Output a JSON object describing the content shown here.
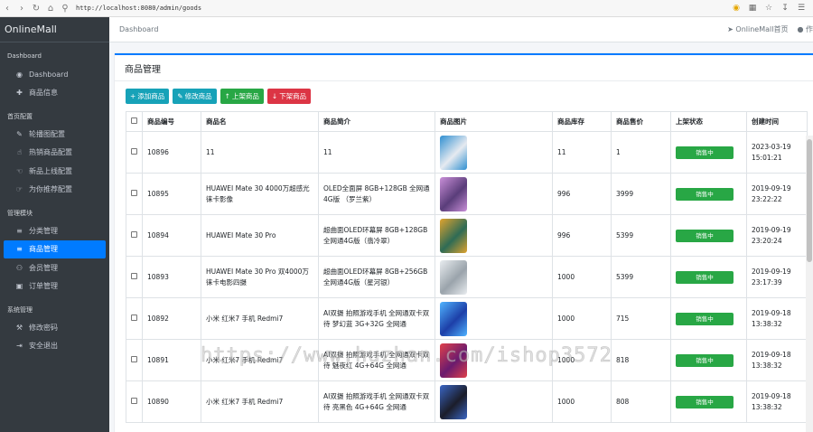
{
  "browser": {
    "url": "http://localhost:8080/admin/goods"
  },
  "sidebar": {
    "brand": "OnlineMall",
    "sections": [
      {
        "title": "Dashboard",
        "items": [
          {
            "icon": "palette-icon",
            "label": "Dashboard"
          },
          {
            "icon": "plus-icon",
            "label": "商品信息"
          }
        ]
      },
      {
        "title": "首页配置",
        "items": [
          {
            "icon": "edit-icon",
            "label": "轮播图配置"
          },
          {
            "icon": "thumbs-up-icon",
            "label": "热销商品配置"
          },
          {
            "icon": "hand-pointer-icon",
            "label": "新品上线配置"
          },
          {
            "icon": "hand-point-icon",
            "label": "为你推荐配置"
          }
        ]
      },
      {
        "title": "管理模块",
        "items": [
          {
            "icon": "list-icon",
            "label": "分类管理"
          },
          {
            "icon": "list-icon",
            "label": "商品管理",
            "active": true
          },
          {
            "icon": "users-icon",
            "label": "会员管理"
          },
          {
            "icon": "order-icon",
            "label": "订单管理"
          }
        ]
      },
      {
        "title": "系统管理",
        "items": [
          {
            "icon": "lock-icon",
            "label": "修改密码"
          },
          {
            "icon": "logout-icon",
            "label": "安全退出"
          }
        ]
      }
    ]
  },
  "topbar": {
    "breadcrumb": "Dashboard",
    "home_link": "OnlineMall首页",
    "user_link": "作"
  },
  "page": {
    "title": "商品管理",
    "buttons": {
      "add": "添加商品",
      "edit": "修改商品",
      "on": "上架商品",
      "off": "下架商品"
    }
  },
  "table": {
    "headers": [
      "商品编号",
      "商品名",
      "商品简介",
      "商品图片",
      "商品库存",
      "商品售价",
      "上架状态",
      "创建时间"
    ],
    "rows": [
      {
        "id": "10896",
        "name": "11",
        "intro": "11",
        "stock": "11",
        "price": "1",
        "status": "销售中",
        "created": "2023-03-19 15:01:21",
        "img_color": "#e6eaf0",
        "img_accent": "#2f8fd1"
      },
      {
        "id": "10895",
        "name": "HUAWEI Mate 30 4000万超感光徕卡影像",
        "intro": "OLED全面屏 8GB+128GB 全网通4G版 （罗兰紫）",
        "stock": "996",
        "price": "3999",
        "status": "销售中",
        "created": "2019-09-19 23:22:22",
        "img_color": "#5a3d7a",
        "img_accent": "#c98fd8"
      },
      {
        "id": "10894",
        "name": "HUAWEI Mate 30 Pro",
        "intro": "超曲面OLED环幕屏 8GB+128GB 全网通4G版（翡冷翠）",
        "stock": "996",
        "price": "5399",
        "status": "销售中",
        "created": "2019-09-19 23:20:24",
        "img_color": "#2e6b55",
        "img_accent": "#e0a32e"
      },
      {
        "id": "10893",
        "name": "HUAWEI Mate 30 Pro 双4000万徕卡电影四摄",
        "intro": "超曲面OLED环幕屏 8GB+256GB 全网通4G版（星河银）",
        "stock": "1000",
        "price": "5399",
        "status": "销售中",
        "created": "2019-09-19 23:17:39",
        "img_color": "#9aa3ab",
        "img_accent": "#e9edf0"
      },
      {
        "id": "10892",
        "name": "小米 红米7 手机 Redmi7",
        "intro": "AI双摄 拍照游戏手机 全网通双卡双待 梦幻蓝 3G+32G 全网通",
        "stock": "1000",
        "price": "715",
        "status": "销售中",
        "created": "2019-09-18 13:38:32",
        "img_color": "#1d3fa8",
        "img_accent": "#4fb3ff"
      },
      {
        "id": "10891",
        "name": "小米 红米7 手机 Redmi7",
        "intro": "AI双摄 拍照游戏手机 全网通双卡双待 魅夜红 4G+64G 全网通",
        "stock": "1000",
        "price": "818",
        "status": "销售中",
        "created": "2019-09-18 13:38:32",
        "img_color": "#6a1a6e",
        "img_accent": "#e0404a"
      },
      {
        "id": "10890",
        "name": "小米 红米7 手机 Redmi7",
        "intro": "AI双摄 拍照游戏手机 全网通双卡双待 亮黑色 4G+64G 全网通",
        "stock": "1000",
        "price": "808",
        "status": "销售中",
        "created": "2019-09-18 13:38:32",
        "img_color": "#1b1d2a",
        "img_accent": "#3a66c4"
      }
    ]
  },
  "watermark": "https://www.huzhan.com/ishop3572",
  "colors": {
    "primary": "#007bff",
    "info": "#17a2b8",
    "success": "#28a745",
    "danger": "#dc3545",
    "sidebar": "#343a40"
  }
}
